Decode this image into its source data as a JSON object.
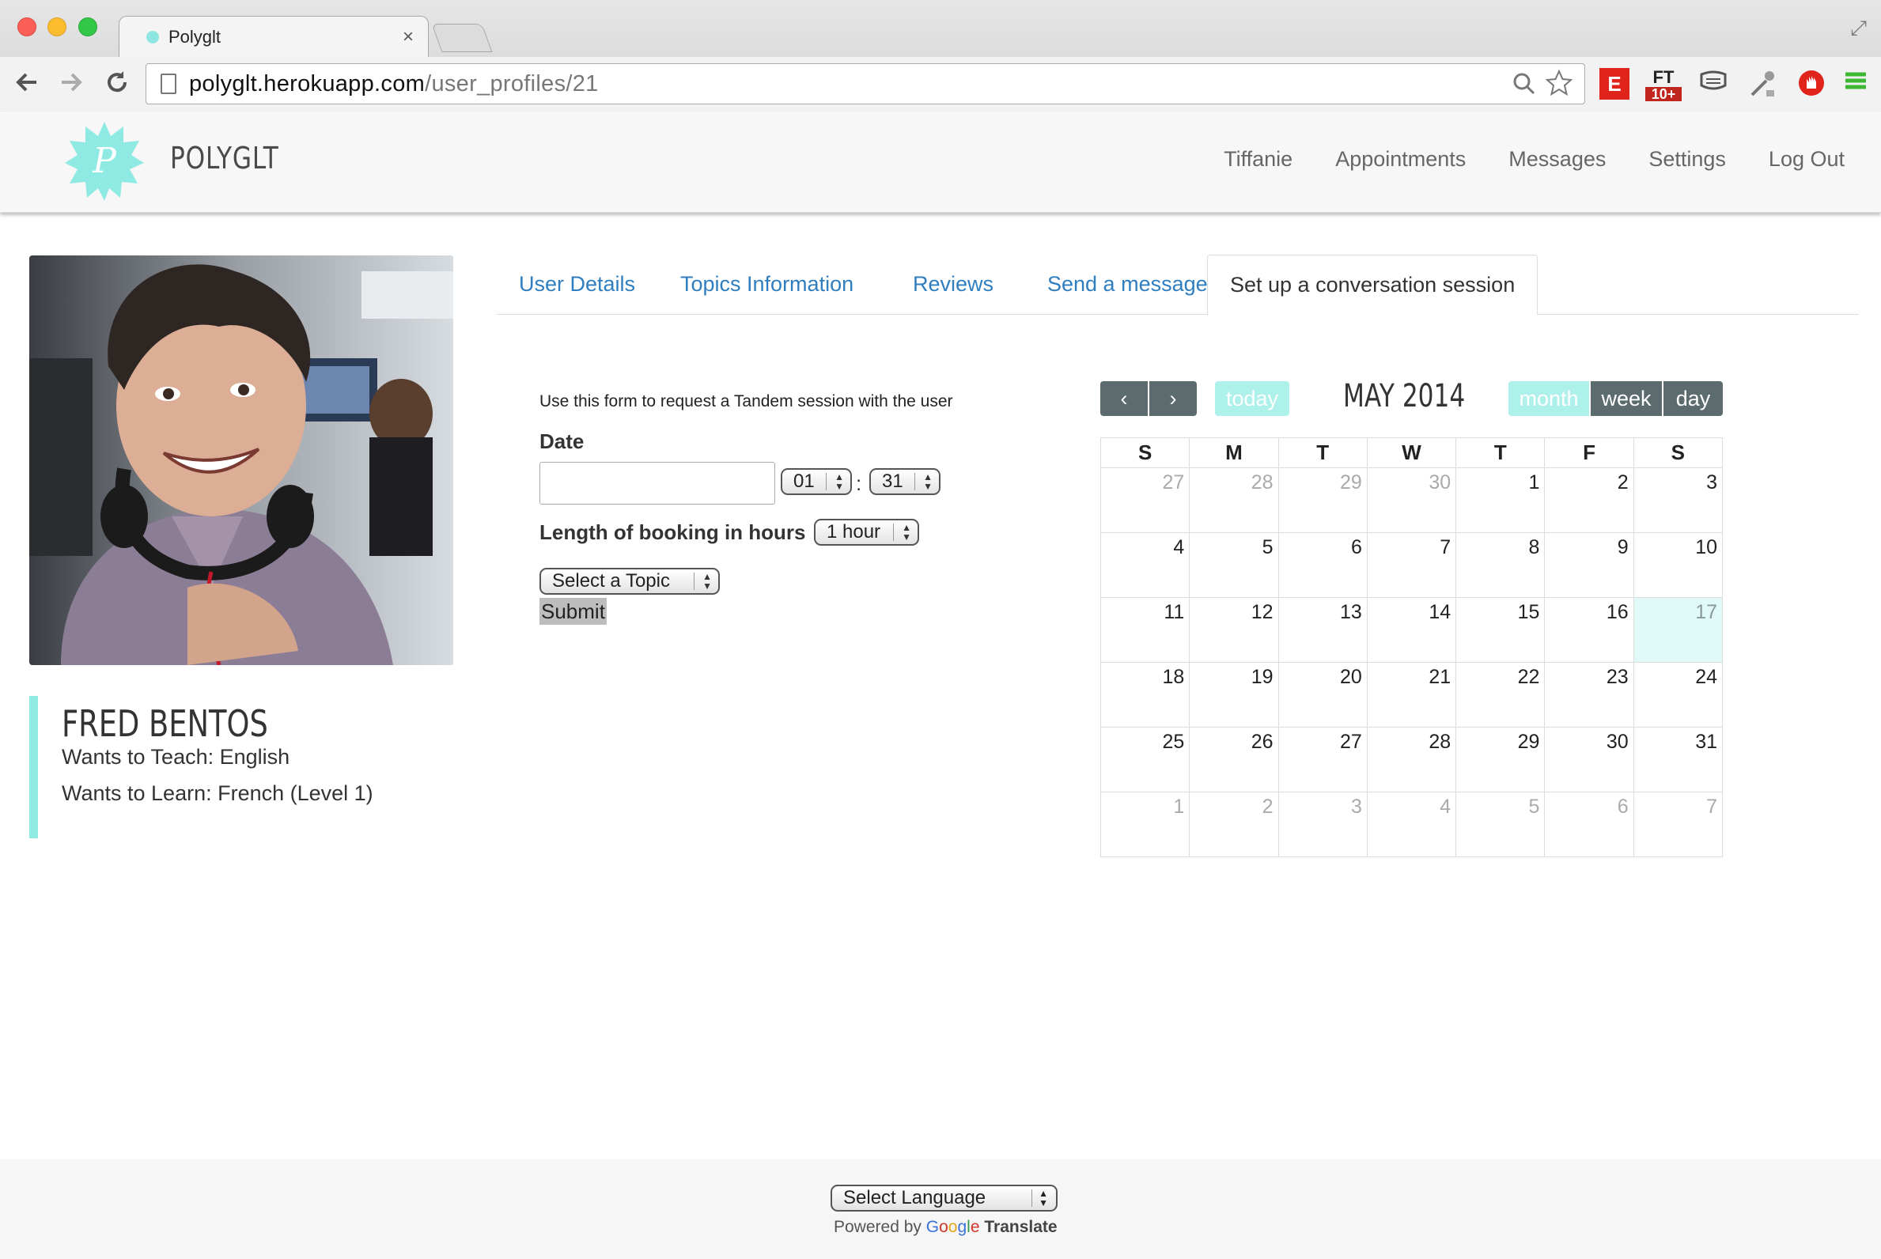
{
  "browser": {
    "tab_title": "Polyglt",
    "tab_close": "×",
    "url_host": "polyglt.herokuapp.com",
    "url_path": "/user_profiles/21",
    "back_icon": "arrow-left-icon",
    "forward_icon": "arrow-right-icon",
    "reload_icon": "reload-icon",
    "extensions": [
      "E",
      "FT",
      "10+"
    ]
  },
  "site": {
    "brand": "POLYGLT",
    "logo_letter": "P",
    "accent": "#8eeae2",
    "nav": [
      "Tiffanie",
      "Appointments",
      "Messages",
      "Settings",
      "Log Out"
    ]
  },
  "profile": {
    "name": "FRED BENTOS",
    "teach": "Wants to Teach: English",
    "learn": "Wants to Learn: French (Level 1)"
  },
  "tabs": [
    "User Details",
    "Topics Information",
    "Reviews",
    "Send a message",
    "Set up a conversation session"
  ],
  "form": {
    "intro": "Use this form to request a Tandem session with the user",
    "date_label": "Date",
    "date_value": "",
    "hour": "01",
    "minute": "31",
    "colon": ":",
    "length_label": "Length of booking in hours",
    "length_value": "1 hour",
    "topic_value": "Select a Topic",
    "submit": "Submit"
  },
  "calendar": {
    "prev": "‹",
    "next": "›",
    "today": "today",
    "title": "MAY 2014",
    "views": [
      "month",
      "week",
      "day"
    ],
    "weekdays": [
      "S",
      "M",
      "T",
      "W",
      "T",
      "F",
      "S"
    ],
    "weeks": [
      [
        "27",
        "28",
        "29",
        "30",
        "1",
        "2",
        "3"
      ],
      [
        "4",
        "5",
        "6",
        "7",
        "8",
        "9",
        "10"
      ],
      [
        "11",
        "12",
        "13",
        "14",
        "15",
        "16",
        "17"
      ],
      [
        "18",
        "19",
        "20",
        "21",
        "22",
        "23",
        "24"
      ],
      [
        "25",
        "26",
        "27",
        "28",
        "29",
        "30",
        "31"
      ],
      [
        "1",
        "2",
        "3",
        "4",
        "5",
        "6",
        "7"
      ]
    ],
    "today_date": "17"
  },
  "footer": {
    "language": "Select Language",
    "powered_by": "Powered by",
    "google": [
      "G",
      "o",
      "o",
      "g",
      "l",
      "e"
    ],
    "translate": "Translate"
  }
}
